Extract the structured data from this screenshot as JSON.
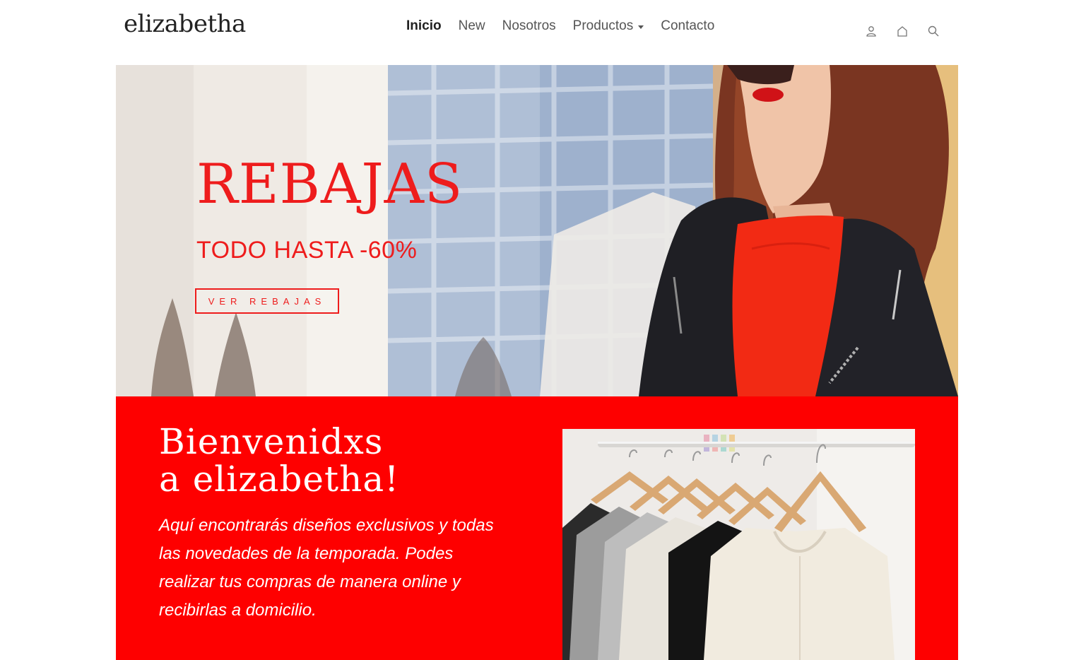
{
  "header": {
    "brand": "elizabetha",
    "nav": [
      {
        "label": "Inicio",
        "active": true
      },
      {
        "label": "New",
        "active": false
      },
      {
        "label": "Nosotros",
        "active": false
      },
      {
        "label": "Productos",
        "active": false,
        "dropdown": true
      },
      {
        "label": "Contacto",
        "active": false
      }
    ],
    "icons": [
      "user-icon",
      "home-icon",
      "search-icon"
    ]
  },
  "hero": {
    "title": "REBAJAS",
    "subtitle": "TODO HASTA -60%",
    "button_label": "VER REBAJAS",
    "image": "woman-leather-jacket-photo"
  },
  "welcome": {
    "title_line1": "Bienvenidxs",
    "title_line2": "a elizabetha!",
    "text": "Aquí encontrarás diseños exclusivos y todas las novedades de la temporada. Podes realizar tus compras de manera online y recibirlas a domicilio.",
    "image": "clothes-rack-photo"
  },
  "colors": {
    "accent": "#fe0000",
    "hero_text": "#ee1c1c",
    "text_dark": "#222222",
    "nav_text": "#555555"
  }
}
